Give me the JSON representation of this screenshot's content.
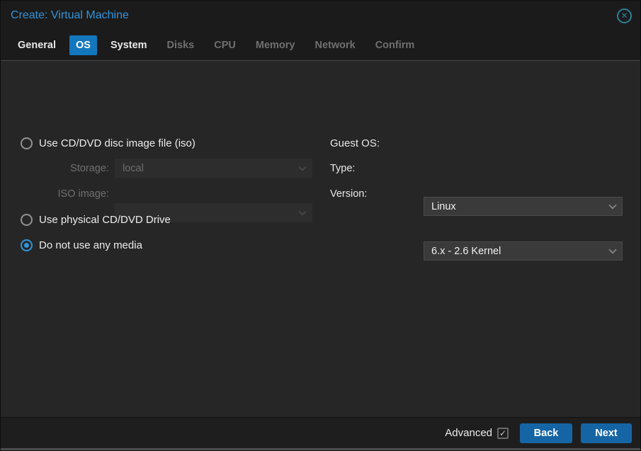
{
  "dialog": {
    "title": "Create: Virtual Machine",
    "close_glyph": "✕"
  },
  "tabs": [
    {
      "label": "General",
      "state": "enabled"
    },
    {
      "label": "OS",
      "state": "active"
    },
    {
      "label": "System",
      "state": "enabled"
    },
    {
      "label": "Disks",
      "state": "disabled"
    },
    {
      "label": "CPU",
      "state": "disabled"
    },
    {
      "label": "Memory",
      "state": "disabled"
    },
    {
      "label": "Network",
      "state": "disabled"
    },
    {
      "label": "Confirm",
      "state": "disabled"
    }
  ],
  "media": {
    "iso_radio": {
      "label": "Use CD/DVD disc image file (iso)",
      "selected": false
    },
    "storage_field": {
      "label": "Storage:",
      "value": "local",
      "disabled": true
    },
    "iso_image_field": {
      "label": "ISO image:",
      "value": "",
      "disabled": true
    },
    "physical_radio": {
      "label": "Use physical CD/DVD Drive",
      "selected": false
    },
    "no_media_radio": {
      "label": "Do not use any media",
      "selected": true
    }
  },
  "guest_os": {
    "heading": "Guest OS:",
    "type_field": {
      "label": "Type:",
      "value": "Linux"
    },
    "version_field": {
      "label": "Version:",
      "value": "6.x - 2.6 Kernel"
    }
  },
  "footer": {
    "advanced_label": "Advanced",
    "advanced_checked": true,
    "check_glyph": "✓",
    "back_label": "Back",
    "next_label": "Next"
  },
  "colors": {
    "accent_tab_blue": "#1377bd",
    "button_blue": "#1565a5",
    "title_blue": "#3394dc",
    "selected_radio_blue": "#3094d8",
    "close_teal": "#2d7f96",
    "body_bg": "#262626",
    "header_bg": "#1b1b1b"
  }
}
